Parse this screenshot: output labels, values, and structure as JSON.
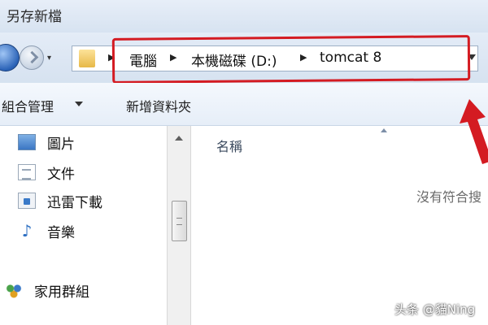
{
  "window": {
    "title": "另存新檔"
  },
  "address_bar": {
    "crumbs": [
      "電腦",
      "本機磁碟 (D:)",
      "tomcat 8"
    ]
  },
  "toolbar": {
    "organize_label": "組合管理",
    "new_folder_label": "新增資料夾"
  },
  "nav_pane": {
    "items": [
      {
        "label": "圖片",
        "icon": "pictures-icon"
      },
      {
        "label": "文件",
        "icon": "documents-icon"
      },
      {
        "label": "迅雷下載",
        "icon": "downloads-icon"
      },
      {
        "label": "音樂",
        "icon": "music-icon"
      }
    ],
    "homegroup": {
      "label": "家用群組",
      "icon": "homegroup-icon"
    }
  },
  "content": {
    "column_name": "名稱",
    "empty_message": "沒有符合搜"
  },
  "watermark": "头条 @貓Ning",
  "colors": {
    "annotation_red": "#d41b22"
  }
}
